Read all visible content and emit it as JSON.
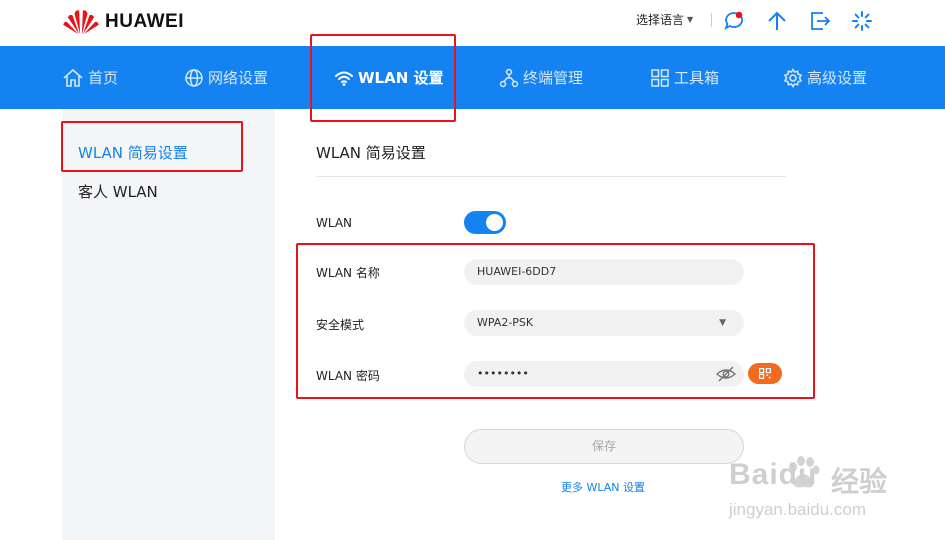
{
  "header": {
    "brand": "HUAWEI",
    "language_label": "选择语言",
    "icons": [
      "chat-bubble-icon",
      "upload-arrow-icon",
      "logout-icon",
      "loading-spinner-icon"
    ]
  },
  "nav": {
    "items": [
      {
        "label": "首页",
        "icon": "home-icon"
      },
      {
        "label": "网络设置",
        "icon": "globe-icon"
      },
      {
        "label": "WLAN 设置",
        "icon": "wifi-icon"
      },
      {
        "label": "终端管理",
        "icon": "devices-tree-icon"
      },
      {
        "label": "工具箱",
        "icon": "grid-tools-icon"
      },
      {
        "label": "高级设置",
        "icon": "gear-icon"
      }
    ],
    "active": "WLAN 设置"
  },
  "sidebar": {
    "items": [
      {
        "label": "WLAN 简易设置",
        "active": true
      },
      {
        "label": "客人 WLAN",
        "active": false
      }
    ]
  },
  "main": {
    "title": "WLAN 简易设置",
    "wlan_label": "WLAN",
    "wlan_enabled": true,
    "name_label": "WLAN 名称",
    "name_value": "HUAWEI-6DD7",
    "security_label": "安全模式",
    "security_value": "WPA2-PSK",
    "password_label": "WLAN 密码",
    "password_value": "••••••••",
    "save_label": "保存",
    "more_link": "更多 WLAN 设置"
  },
  "watermark": {
    "brand": "Baidu",
    "cn": "经验",
    "url": "jingyan.baidu.com"
  },
  "colors": {
    "accent": "#1482f0",
    "highlight_box": "#e8131b",
    "qr_button": "#f36b21"
  }
}
